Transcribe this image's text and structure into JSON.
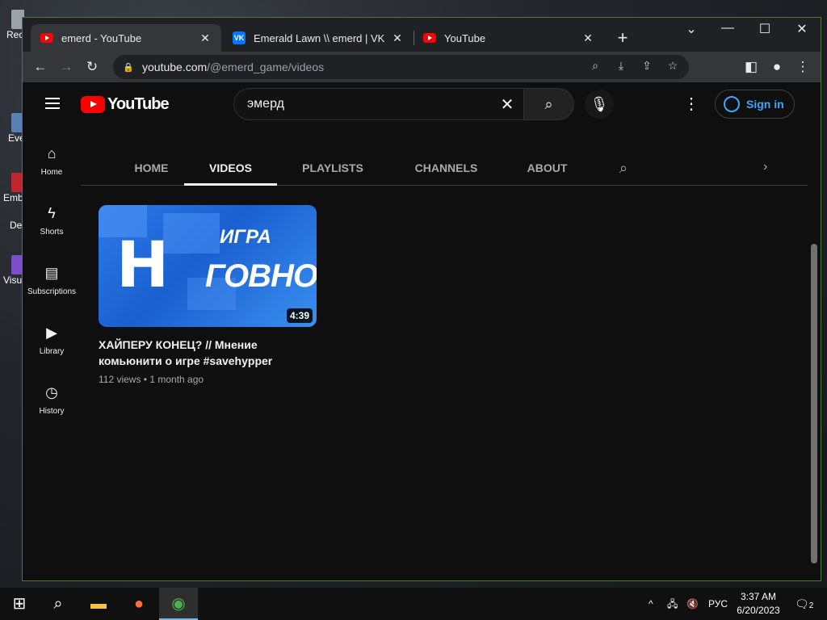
{
  "desktop": {
    "icons": [
      "Rec",
      "Eve",
      "Emb",
      "De",
      "Visu"
    ]
  },
  "browser": {
    "tabs": [
      {
        "title": "emerd - YouTube",
        "favicon": "youtube-icon",
        "active": true
      },
      {
        "title": "Emerald Lawn \\\\ emerd | VK",
        "favicon": "vk-icon",
        "active": false
      },
      {
        "title": "YouTube",
        "favicon": "youtube-icon",
        "active": false
      }
    ],
    "tab_close": "✕",
    "new_tab": "+",
    "url_host": "youtube.com",
    "url_path": "/@emerd_game/videos"
  },
  "youtube": {
    "logo_text": "YouTube",
    "search_value": "эмерд",
    "sign_in": "Sign in",
    "guide": [
      {
        "label": "Home",
        "icon": "home-icon"
      },
      {
        "label": "Shorts",
        "icon": "shorts-icon"
      },
      {
        "label": "Subscriptions",
        "icon": "subscriptions-icon"
      },
      {
        "label": "Library",
        "icon": "library-icon"
      },
      {
        "label": "History",
        "icon": "history-icon"
      }
    ],
    "channel_tabs": [
      "HOME",
      "VIDEOS",
      "PLAYLISTS",
      "CHANNELS",
      "ABOUT"
    ],
    "active_tab": "VIDEOS",
    "video": {
      "thumb_text_1": "ИГРА",
      "thumb_text_2": "ГОВНО?",
      "thumb_letter": "H",
      "duration": "4:39",
      "title": "ХАЙПЕРУ КОНЕЦ? // Мнение комьюнити о игре #savehypper",
      "meta": "112 views • 1 month ago"
    }
  },
  "taskbar": {
    "lang": "РУС",
    "time": "3:37 AM",
    "date": "6/20/2023",
    "notifications": "2"
  },
  "colors": {
    "yt_red": "#ff0000",
    "link_blue": "#3ea6ff",
    "page_bg": "#0f0f0f"
  }
}
